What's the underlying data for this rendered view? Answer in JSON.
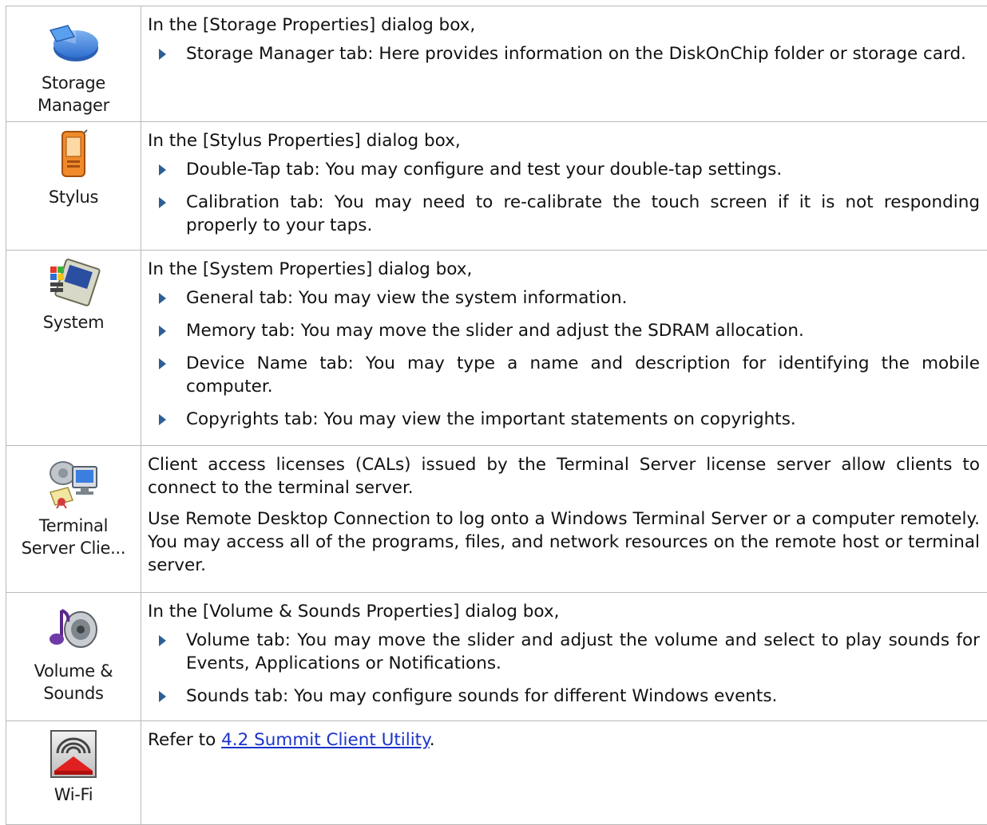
{
  "rows": [
    {
      "icon": "storage-manager-icon",
      "label_lines": [
        "Storage",
        "Manager"
      ],
      "intro": "In the [Storage Properties] dialog box,",
      "bullets": [
        "Storage Manager tab: Here provides information on the DiskOnChip folder or storage card."
      ]
    },
    {
      "icon": "stylus-icon",
      "label_lines": [
        "Stylus"
      ],
      "intro": "In the [Stylus Properties] dialog box,",
      "bullets": [
        "Double-Tap tab: You may configure and test your double-tap settings.",
        "Calibration tab: You may need to re-calibrate the touch screen if it is not responding properly to your taps."
      ]
    },
    {
      "icon": "system-icon",
      "label_lines": [
        "System"
      ],
      "intro": "In the [System Properties] dialog box,",
      "bullets": [
        "General tab: You may view the system information.",
        "Memory tab: You may move the slider and adjust the SDRAM allocation.",
        "Device Name tab: You may type a name and description for identifying the mobile computer.",
        "Copyrights tab: You may view the important statements on copyrights."
      ]
    },
    {
      "icon": "terminal-server-client-icon",
      "label_lines": [
        "Terminal",
        "Server Clie..."
      ],
      "paragraphs": [
        "Client access licenses (CALs) issued by the Terminal Server license server allow clients to connect to the terminal server.",
        "Use Remote Desktop Connection to log onto a Windows Terminal Server or a computer remotely. You may access all of the programs, files, and network resources on the remote host or terminal server."
      ]
    },
    {
      "icon": "volume-sounds-icon",
      "label_lines": [
        "Volume &",
        "Sounds"
      ],
      "intro": "In the [Volume & Sounds Properties] dialog box,",
      "bullets": [
        "Volume tab: You may move the slider and adjust the volume and select to play sounds for Events, Applications or Notifications.",
        "Sounds tab: You may configure sounds for different Windows events."
      ]
    },
    {
      "icon": "wifi-icon",
      "label_lines": [
        "Wi-Fi"
      ],
      "refer_prefix": "Refer to ",
      "refer_link": "4.2 Summit Client Utility",
      "refer_suffix": "."
    }
  ],
  "colors": {
    "border": "#b9b9b9",
    "bullet_arrow": "#2d5f95",
    "link": "#1b34c8"
  }
}
